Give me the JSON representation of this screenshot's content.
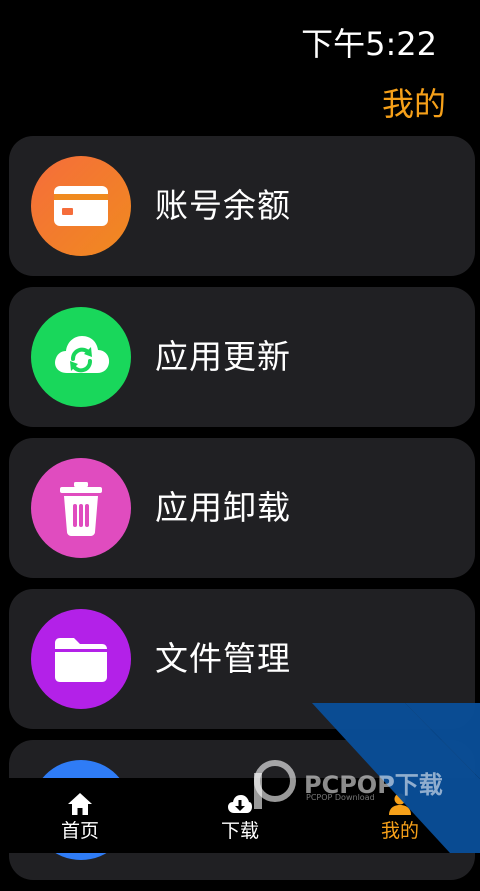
{
  "status_bar": {
    "time": "下午5:22"
  },
  "header": {
    "title": "我的"
  },
  "menu": {
    "items": [
      {
        "label": "账号余额",
        "icon": "card-icon",
        "color": "#f3792e"
      },
      {
        "label": "应用更新",
        "icon": "cloud-sync-icon",
        "color": "#19d75b"
      },
      {
        "label": "应用卸载",
        "icon": "trash-icon",
        "color": "#e04cbf"
      },
      {
        "label": "文件管理",
        "icon": "folder-icon",
        "color": "#b321e8"
      },
      {
        "label": "",
        "icon": "blue-circle-icon",
        "color": "#2f7cf6"
      }
    ]
  },
  "bottom_nav": {
    "items": [
      {
        "label": "首页",
        "icon": "home-icon"
      },
      {
        "label": "下载",
        "icon": "cloud-download-icon"
      },
      {
        "label": "我的",
        "icon": "person-icon",
        "active": true
      }
    ]
  },
  "watermark": {
    "text": "PCPOP下载",
    "subtext": "PCPOP Download"
  },
  "colors": {
    "accent": "#f6a019",
    "card_bg": "#202023",
    "background": "#000000"
  }
}
